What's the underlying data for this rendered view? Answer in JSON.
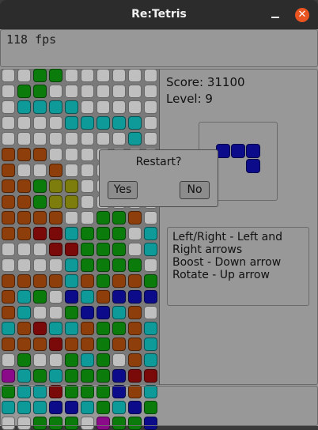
{
  "window": {
    "title": "Re:Tetris",
    "close_glyph": "✕",
    "minimize_icon": "minimize-icon",
    "close_icon": "close-icon"
  },
  "hud": {
    "fps": "118 fps",
    "score": "Score: 31100",
    "level": "Level: 9"
  },
  "help": [
    "Left/Right - Left and",
    "Right arrows",
    "Boost - Down arrow",
    "Rotate - Up arrow"
  ],
  "dialog": {
    "title": "Restart?",
    "yes": "Yes",
    "no": "No"
  },
  "colors": {
    "E": "#bfbfbf",
    "G": "#0b7b0b",
    "T": "#0f9a9a",
    "B": "#0c0c8a",
    "R": "#7a0a0a",
    "O": "#8e3e0a",
    "Y": "#7d7d0e",
    "P": "#8a0a8a"
  },
  "board": [
    "EEGGEEEEEE",
    "EGGEEEEEEE",
    "ETTTTEEEEE",
    "EEEETTTTTE",
    "EEEEEEEETE",
    "OOOEEEEEEE",
    "OEEOEEEEEE",
    "OOGYYEEEEE",
    "OOGYYEEEEE",
    "OOOOEEGGOE",
    "OORRTGGGET",
    "EEERRGGGET",
    "EEEETGGGGE",
    "OOOOTOGOOG",
    "OTGEBTOBBB",
    "OTEEGBBTOE",
    "TORTTOGGOT",
    "OOOROOGOOT",
    "EGEEGTGEOT",
    "PTGTGGGBRR",
    "GTTRGGGBOT",
    "TTTBBTGTBG",
    "EEGGGEPGGB"
  ],
  "next_piece": [
    "BBB",
    "..B"
  ]
}
